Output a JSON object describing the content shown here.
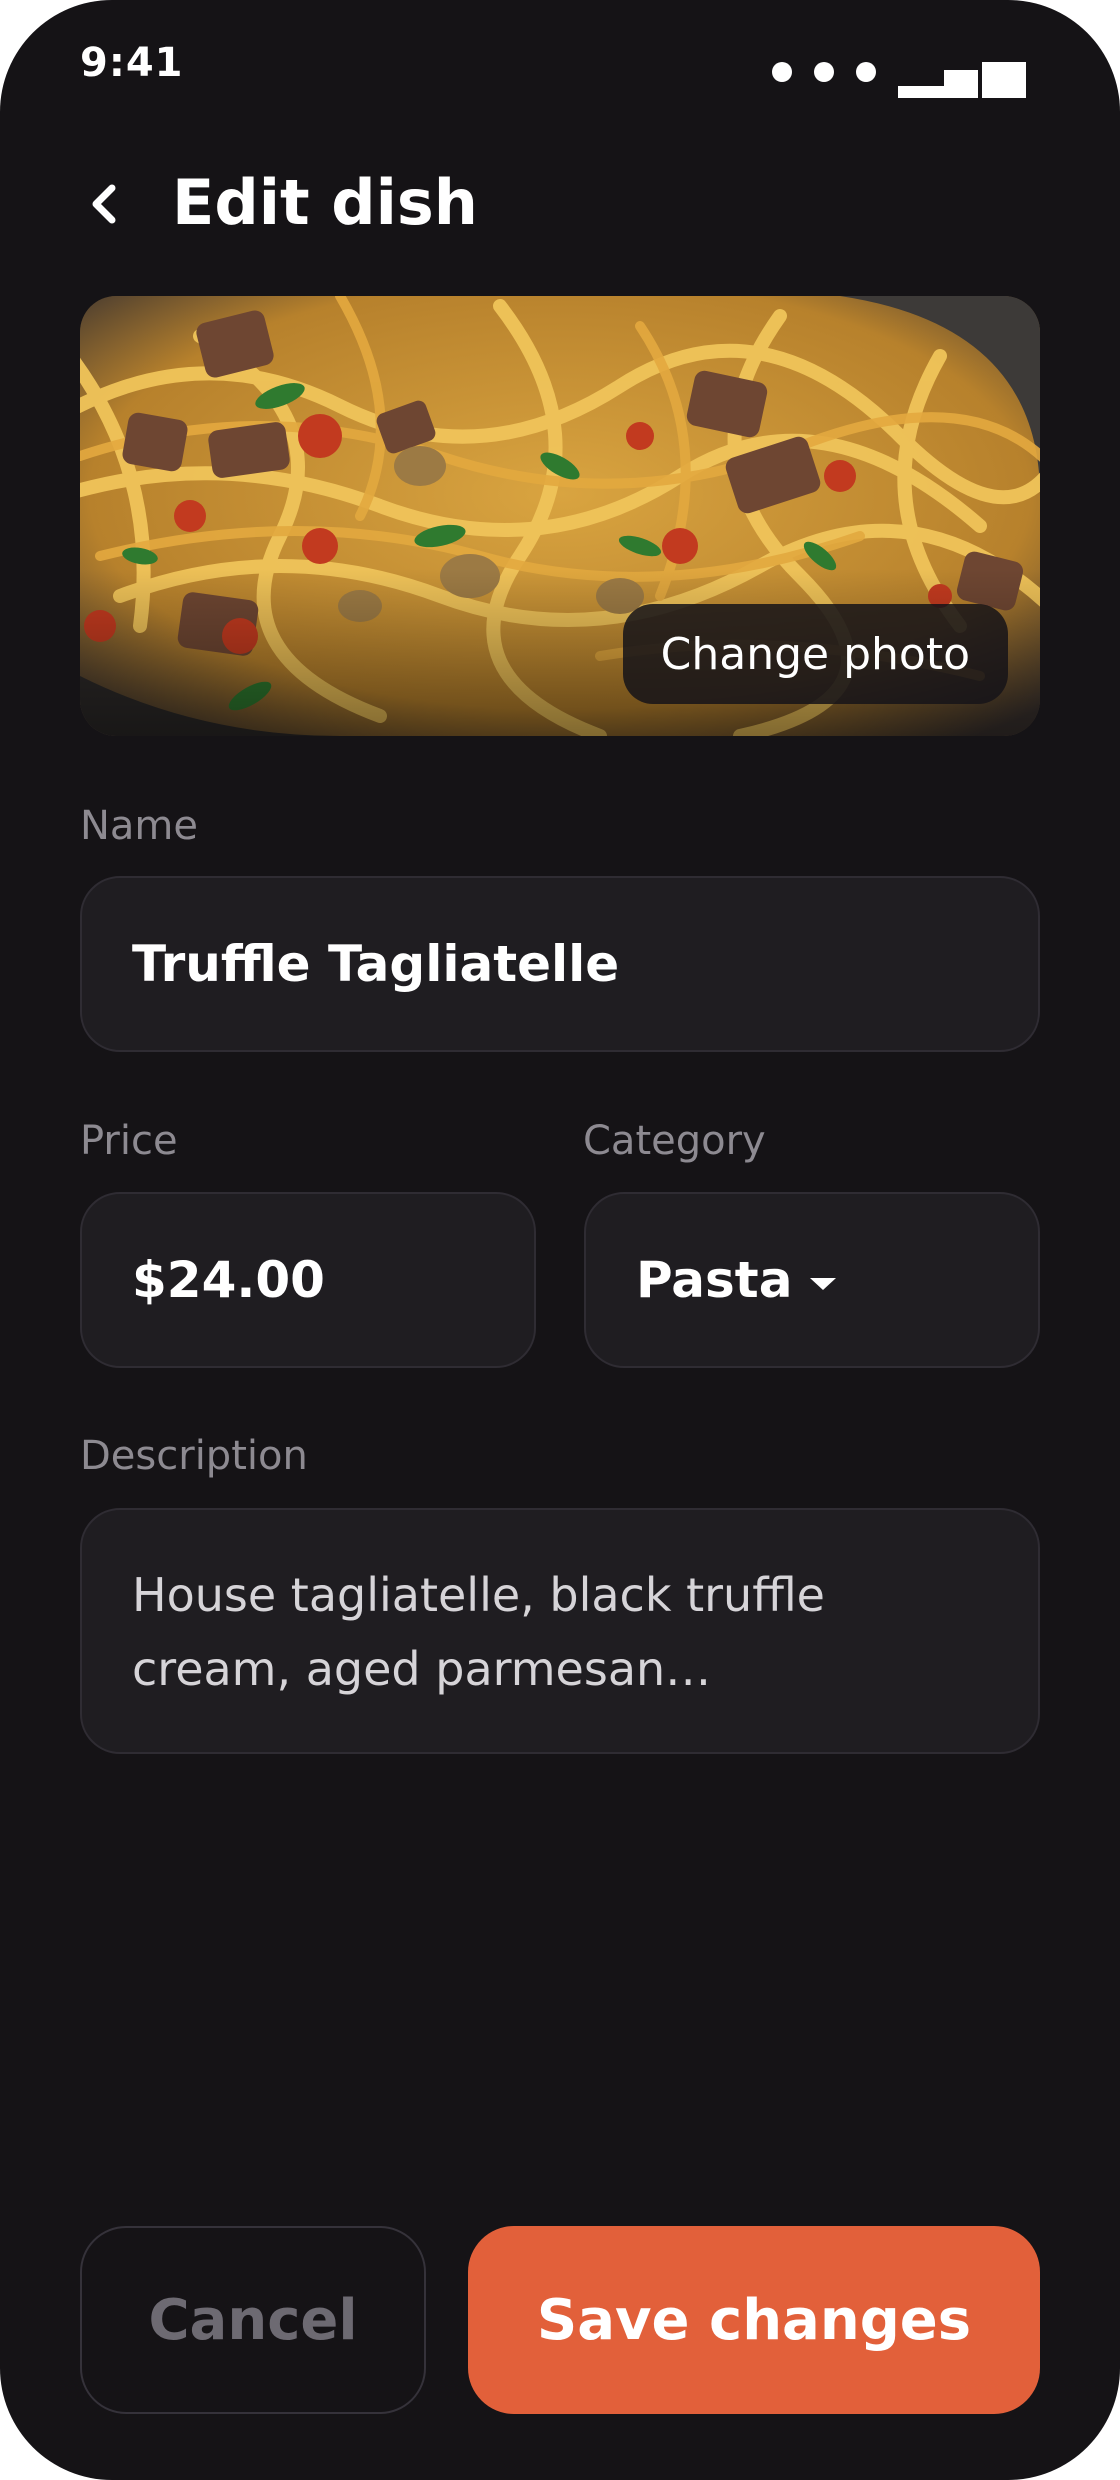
{
  "status_bar": {
    "time": "9:41"
  },
  "header": {
    "title": "Edit dish",
    "back_icon": "chevron-left-icon"
  },
  "photo": {
    "change_label": "Change photo"
  },
  "form": {
    "name": {
      "label": "Name",
      "value": "Truffle Tagliatelle"
    },
    "price": {
      "label": "Price",
      "value": "$24.00"
    },
    "category": {
      "label": "Category",
      "value": "Pasta",
      "icon": "caret-down-icon"
    },
    "description": {
      "label": "Description",
      "value": "House tagliatelle, black truffle cream, aged parmesan…"
    }
  },
  "actions": {
    "cancel_label": "Cancel",
    "save_label": "Save changes"
  },
  "colors": {
    "background": "#151316",
    "field_background": "#1f1d21",
    "accent": "#e2603a",
    "label": "#8d8a91"
  }
}
